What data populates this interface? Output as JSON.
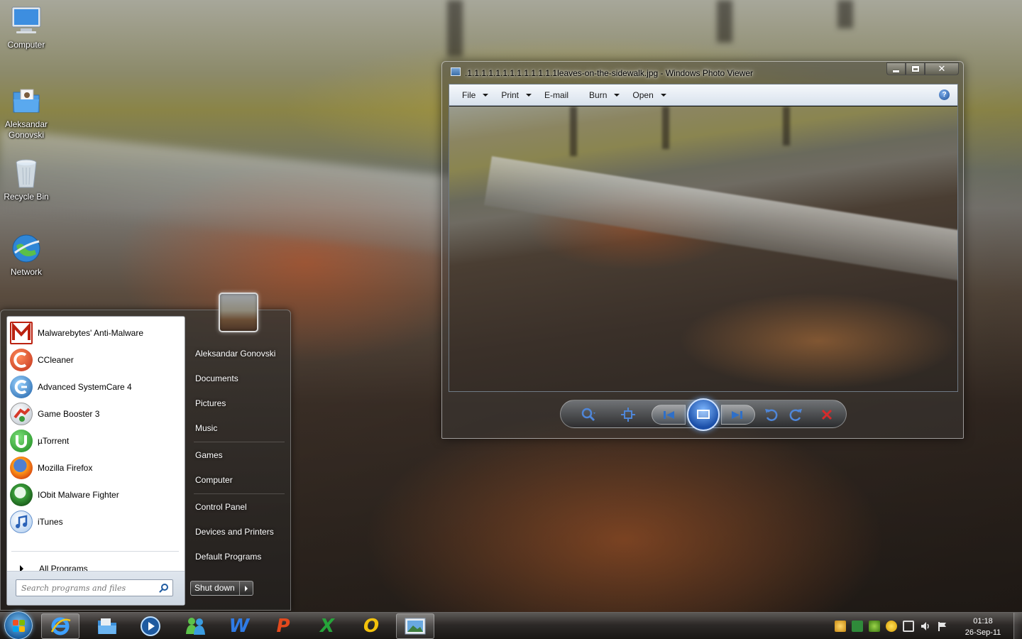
{
  "desktop": {
    "icons": [
      {
        "label": "Computer",
        "icon": "computer-icon"
      },
      {
        "label": "Aleksandar Gonovski",
        "icon": "user-folder-icon"
      },
      {
        "label": "Recycle Bin",
        "icon": "recycle-bin-icon"
      },
      {
        "label": "Network",
        "icon": "network-icon"
      }
    ]
  },
  "start_menu": {
    "programs": [
      {
        "label": "Malwarebytes' Anti-Malware",
        "icon": "malwarebytes-icon"
      },
      {
        "label": "CCleaner",
        "icon": "ccleaner-icon"
      },
      {
        "label": "Advanced SystemCare 4",
        "icon": "advanced-systemcare-icon"
      },
      {
        "label": "Game Booster 3",
        "icon": "game-booster-icon"
      },
      {
        "label": "µTorrent",
        "icon": "utorrent-icon"
      },
      {
        "label": "Mozilla Firefox",
        "icon": "firefox-icon"
      },
      {
        "label": "IObit Malware Fighter",
        "icon": "iobit-malware-fighter-icon"
      },
      {
        "label": "iTunes",
        "icon": "itunes-icon"
      }
    ],
    "all_programs": "All Programs",
    "search_placeholder": "Search programs and files",
    "right_links": [
      "Aleksandar Gonovski",
      "Documents",
      "Pictures",
      "Music",
      "Games",
      "Computer",
      "Control Panel",
      "Devices and Printers",
      "Default Programs"
    ],
    "shutdown_label": "Shut down"
  },
  "photo_viewer": {
    "title": ".1.1.1.1.1.1.1.1.1.1.1.1.1leaves-on-the-sidewalk.jpg - Windows Photo Viewer",
    "menu": [
      "File",
      "Print",
      "E-mail",
      "Burn",
      "Open"
    ],
    "help": "?",
    "caption_close": "✕",
    "controls": [
      "zoom",
      "actual-size",
      "previous",
      "slide-show",
      "next",
      "rotate-counterclockwise",
      "rotate-clockwise",
      "delete"
    ]
  },
  "taskbar": {
    "pinned": [
      {
        "name": "internet-explorer",
        "active": true
      },
      {
        "name": "windows-explorer",
        "active": false
      },
      {
        "name": "media-player",
        "active": false
      },
      {
        "name": "messenger",
        "active": false
      },
      {
        "name": "word",
        "letter": "W",
        "color": "#2f7be6",
        "active": false
      },
      {
        "name": "powerpoint",
        "letter": "P",
        "color": "#e2491d",
        "active": false
      },
      {
        "name": "excel",
        "letter": "X",
        "color": "#26a43a",
        "active": false
      },
      {
        "name": "outlook",
        "letter": "O",
        "color": "#f3c20b",
        "active": false
      },
      {
        "name": "photo-viewer",
        "active": true
      }
    ],
    "clock_time": "01:18",
    "clock_date": "26-Sep-11"
  },
  "colors": {
    "accent_blue": "#1e5aa0",
    "viewer_glass": "#3c3a38",
    "taskbar_dark": "#1a1816"
  }
}
